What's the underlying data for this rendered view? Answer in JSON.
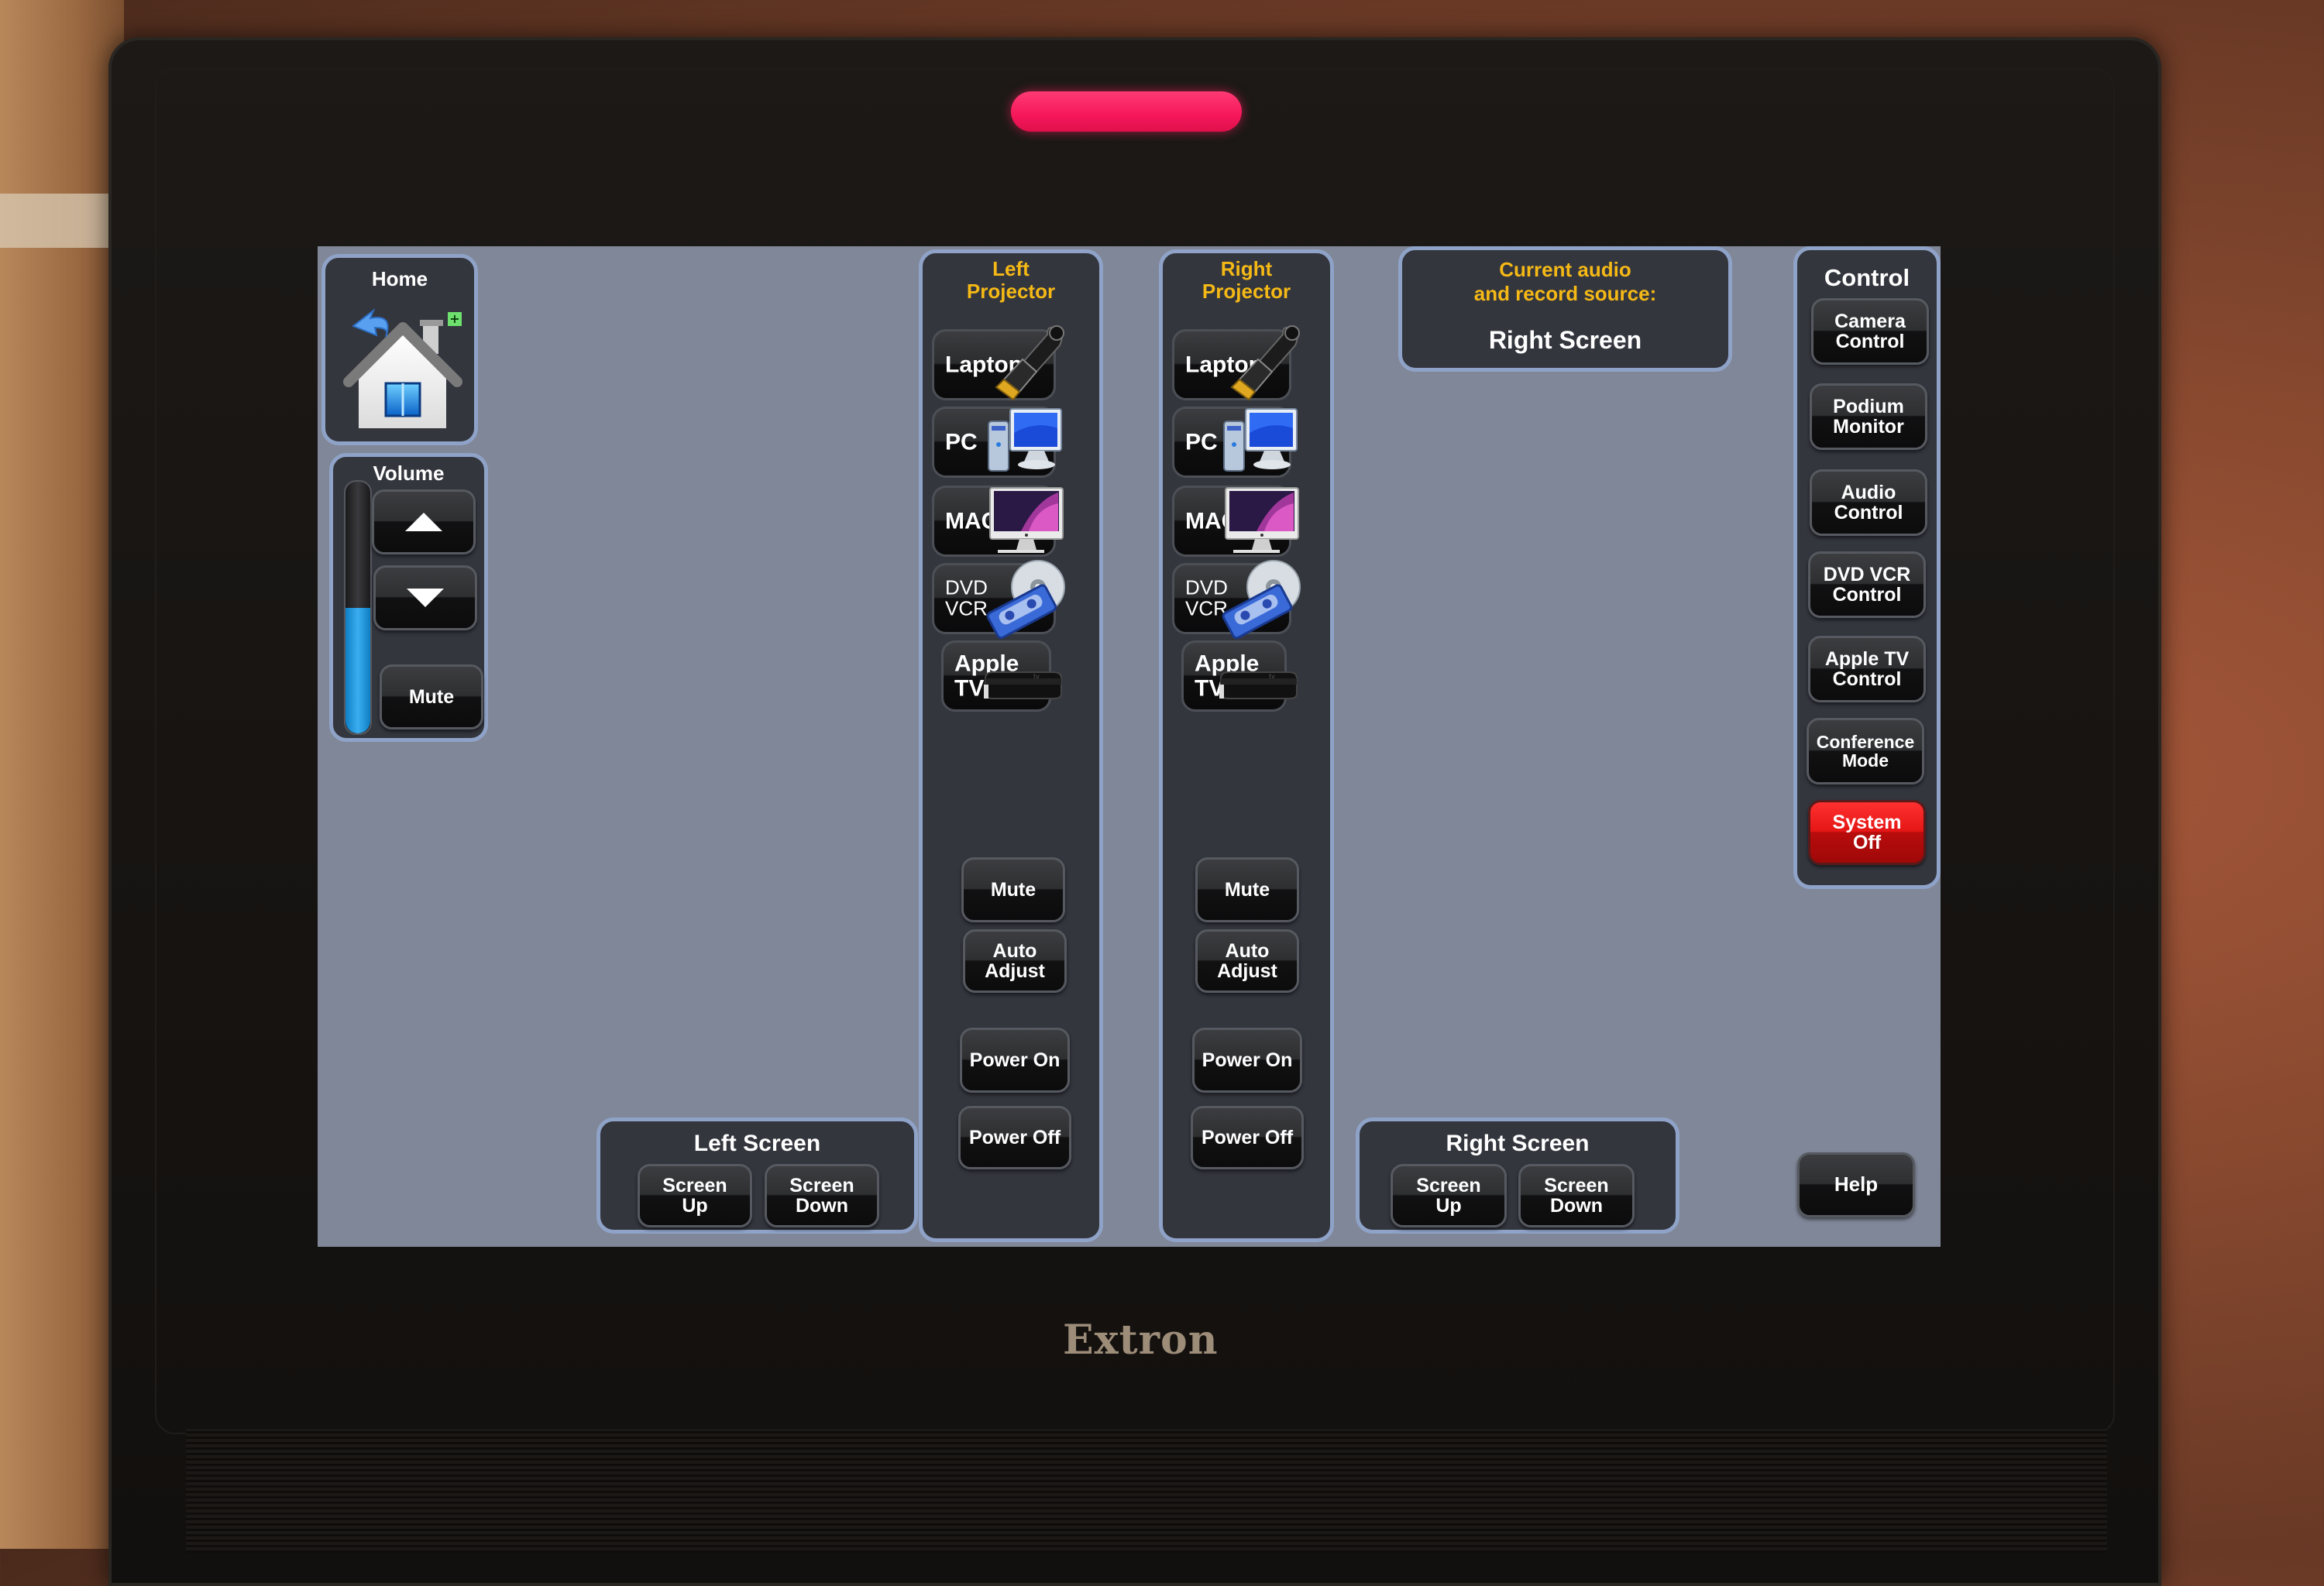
{
  "device": {
    "brand": "Extron",
    "indicator_color": "#f5175a"
  },
  "home": {
    "label": "Home",
    "icon": "home-icon"
  },
  "volume": {
    "label": "Volume",
    "level_percent": 50,
    "up_icon": "triangle-up-icon",
    "down_icon": "triangle-down-icon",
    "mute_label": "Mute"
  },
  "left_projector": {
    "title_line1": "Left",
    "title_line2": "Projector",
    "sources": [
      {
        "label_line1": "Laptop",
        "label_line2": "",
        "icon": "hdmi-cable-icon"
      },
      {
        "label_line1": "PC",
        "label_line2": "",
        "icon": "desktop-pc-icon"
      },
      {
        "label_line1": "MAC",
        "label_line2": "",
        "icon": "imac-icon"
      },
      {
        "label_line1": "DVD",
        "label_line2": "VCR",
        "icon": "dvd-vhs-icon"
      },
      {
        "label_line1": "Apple",
        "label_line2": "TV",
        "icon": "apple-tv-icon"
      }
    ],
    "mute_label": "Mute",
    "auto_adjust_line1": "Auto",
    "auto_adjust_line2": "Adjust",
    "power_on_label": "Power On",
    "power_off_label": "Power Off"
  },
  "right_projector": {
    "title_line1": "Right",
    "title_line2": "Projector",
    "sources": [
      {
        "label_line1": "Laptop",
        "label_line2": "",
        "icon": "hdmi-cable-icon"
      },
      {
        "label_line1": "PC",
        "label_line2": "",
        "icon": "desktop-pc-icon"
      },
      {
        "label_line1": "MAC",
        "label_line2": "",
        "icon": "imac-icon"
      },
      {
        "label_line1": "DVD",
        "label_line2": "VCR",
        "icon": "dvd-vhs-icon"
      },
      {
        "label_line1": "Apple",
        "label_line2": "TV",
        "icon": "apple-tv-icon"
      }
    ],
    "mute_label": "Mute",
    "auto_adjust_line1": "Auto",
    "auto_adjust_line2": "Adjust",
    "power_on_label": "Power On",
    "power_off_label": "Power Off"
  },
  "audio_source": {
    "caption_line1": "Current audio",
    "caption_line2": "and record source:",
    "value": "Right Screen"
  },
  "control": {
    "title": "Control",
    "buttons": [
      {
        "line1": "Camera",
        "line2": "Control"
      },
      {
        "line1": "Podium",
        "line2": "Monitor"
      },
      {
        "line1": "Audio",
        "line2": "Control"
      },
      {
        "line1": "DVD VCR",
        "line2": "Control"
      },
      {
        "line1": "Apple TV",
        "line2": "Control"
      },
      {
        "line1": "Conference",
        "line2": "Mode"
      }
    ],
    "system_off_line1": "System",
    "system_off_line2": "Off",
    "system_off_color": "#e51616"
  },
  "left_screen": {
    "title": "Left Screen",
    "up_line1": "Screen",
    "up_line2": "Up",
    "down_line1": "Screen",
    "down_line2": "Down"
  },
  "right_screen": {
    "title": "Right Screen",
    "up_line1": "Screen",
    "up_line2": "Up",
    "down_line1": "Screen",
    "down_line2": "Down"
  },
  "help": {
    "label": "Help"
  },
  "colors": {
    "screen_bg": "#808798",
    "panel_bg": "#34363e",
    "panel_border": "#8fa3c8",
    "accent_gold": "#f5b916",
    "volume_fill": "#2a9ee0"
  }
}
